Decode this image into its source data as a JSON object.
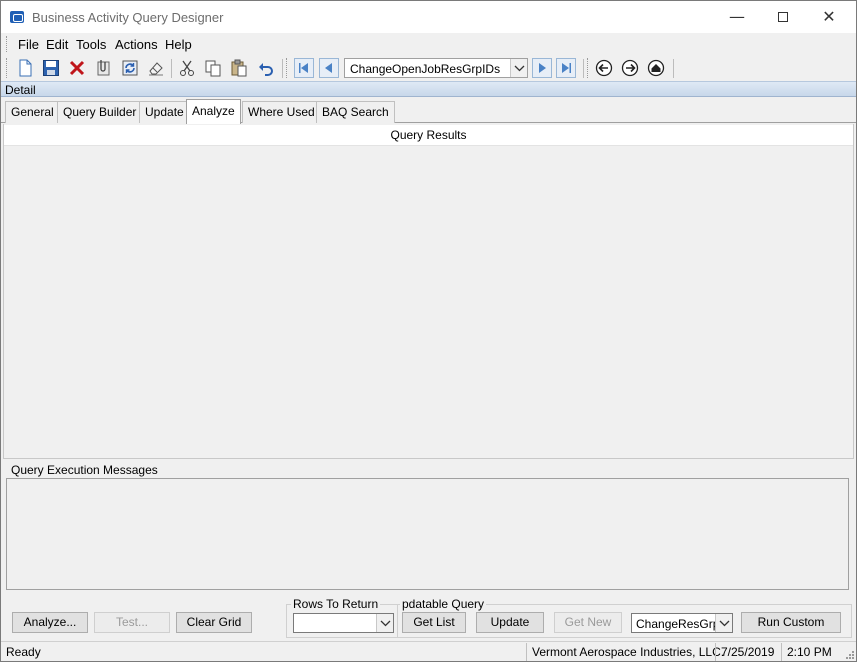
{
  "window": {
    "title": "Business Activity Query Designer",
    "minimize_glyph": "—",
    "close_glyph": "✕"
  },
  "menu": {
    "items": [
      "File",
      "Edit",
      "Tools",
      "Actions",
      "Help"
    ]
  },
  "toolbar": {
    "icons": [
      "new-icon",
      "save-icon",
      "delete-icon",
      "attach-icon",
      "refresh-icon",
      "clear-icon",
      "cut-icon",
      "copy-icon",
      "paste-icon",
      "undo-icon"
    ],
    "query_id": "ChangeOpenJobResGrpIDs",
    "nav_icons": [
      "first-record-icon",
      "previous-record-icon",
      "next-record-icon",
      "last-record-icon",
      "back-icon",
      "forward-icon",
      "home-icon"
    ]
  },
  "detail": {
    "label": "Detail"
  },
  "tabs": [
    {
      "label": "General",
      "active": false
    },
    {
      "label": "Query Builder",
      "active": false
    },
    {
      "label": "Update",
      "active": false
    },
    {
      "label": "Analyze",
      "active": true
    },
    {
      "label": "Where Used",
      "active": false
    },
    {
      "label": "BAQ Search",
      "active": false
    }
  ],
  "results": {
    "header": "Query Results"
  },
  "messages": {
    "label": "Query Execution Messages"
  },
  "buttons": {
    "analyze": "Analyze...",
    "test": "Test...",
    "clear_grid": "Clear Grid",
    "get_list": "Get List",
    "update": "Update",
    "get_new": "Get New",
    "run_custom": "Run Custom"
  },
  "rows_to_return": {
    "label": "Rows To Return",
    "value": ""
  },
  "updatable_query": {
    "label": "pdatable Query",
    "selected": "ChangeResGrp"
  },
  "status": {
    "text": "Ready",
    "company": "Vermont Aerospace Industries, LLC.",
    "date": "7/25/2019",
    "time": "2:10 PM"
  },
  "colors": {
    "accent": "#1f5fb5",
    "detail_bar": "#c7d7ea",
    "delete_red": "#c0161b"
  }
}
